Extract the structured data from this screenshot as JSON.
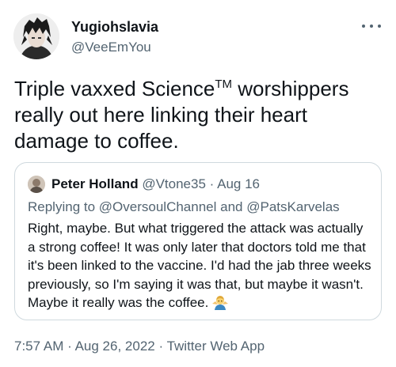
{
  "author": {
    "display_name": "Yugiohslavia",
    "handle": "@VeeEmYou",
    "avatar_icon": "anime-character-avatar"
  },
  "tweet": {
    "text_before_tm": "Triple vaxxed Science",
    "tm": "TM",
    "text_after_tm": " worshippers really out here linking their heart damage to coffee."
  },
  "quote": {
    "name": "Peter Holland",
    "handle": "@Vtone35",
    "separator": "·",
    "date": "Aug 16",
    "replying_prefix": "Replying to",
    "reply_user_1": "@OversoulChannel",
    "reply_and": "and",
    "reply_user_2": "@PatsKarvelas",
    "text": "Right, maybe. But what triggered the attack was actually a strong coffee! It was only later that doctors told me that it's been linked to the vaccine. I'd had the jab three weeks previously, so I'm saying it was that, but maybe it wasn't. Maybe it really was the coffee.",
    "emoji_icon": "man-shrugging-emoji"
  },
  "meta": {
    "time": "7:57 AM",
    "sep1": "·",
    "date": "Aug 26, 2022",
    "sep2": "·",
    "source": "Twitter Web App"
  },
  "colors": {
    "text": "#0f1419",
    "secondary": "#536471",
    "border": "#cfd9de"
  }
}
